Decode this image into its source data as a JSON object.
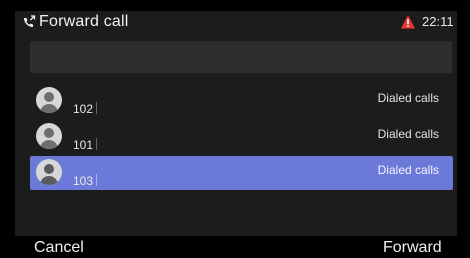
{
  "title": "Forward call",
  "status": {
    "time": "22:11",
    "alert_icon": "warning-icon",
    "alert_color": "#e53935"
  },
  "search": {
    "value": "",
    "placeholder": ""
  },
  "contacts": [
    {
      "number": "102",
      "type": "Dialed calls",
      "selected": false
    },
    {
      "number": "101",
      "type": "Dialed calls",
      "selected": false
    },
    {
      "number": "103",
      "type": "Dialed calls",
      "selected": true
    }
  ],
  "softkeys": {
    "left": "Cancel",
    "right": "Forward"
  },
  "colors": {
    "selected_row": "#6b7ad8",
    "background": "#1c1c1c",
    "search_bg": "#2e2e2e"
  }
}
